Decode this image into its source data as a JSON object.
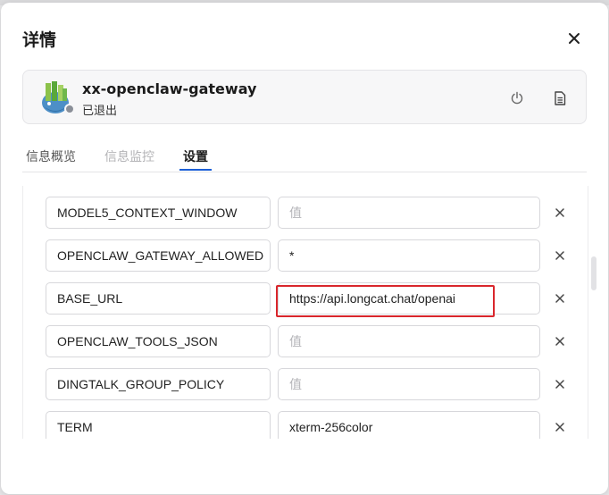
{
  "dialog": {
    "title": "详情",
    "close_icon": "close-icon"
  },
  "app": {
    "name": "xx-openclaw-gateway",
    "status": "已退出",
    "status_color": "#8a8f98",
    "avatar_icon": "app-logo-icon",
    "actions": [
      {
        "icon": "power-icon"
      },
      {
        "icon": "document-icon"
      }
    ]
  },
  "tabs": [
    {
      "label": "信息概览",
      "state": "normal"
    },
    {
      "label": "信息监控",
      "state": "disabled"
    },
    {
      "label": "设置",
      "state": "active"
    }
  ],
  "env_vars": [
    {
      "key": "MODEL5_CONTEXT_WINDOW",
      "value": "",
      "placeholder": "值"
    },
    {
      "key": "OPENCLAW_GATEWAY_ALLOWED",
      "value": "*",
      "placeholder": "值"
    },
    {
      "key": "BASE_URL",
      "value": "https://api.longcat.chat/openai",
      "placeholder": "值"
    },
    {
      "key": "OPENCLAW_TOOLS_JSON",
      "value": "",
      "placeholder": "值"
    },
    {
      "key": "DINGTALK_GROUP_POLICY",
      "value": "",
      "placeholder": "值"
    },
    {
      "key": "TERM",
      "value": "xterm-256color",
      "placeholder": "值"
    }
  ],
  "colors": {
    "accent": "#1b5fd6",
    "highlight": "#d9262c"
  }
}
